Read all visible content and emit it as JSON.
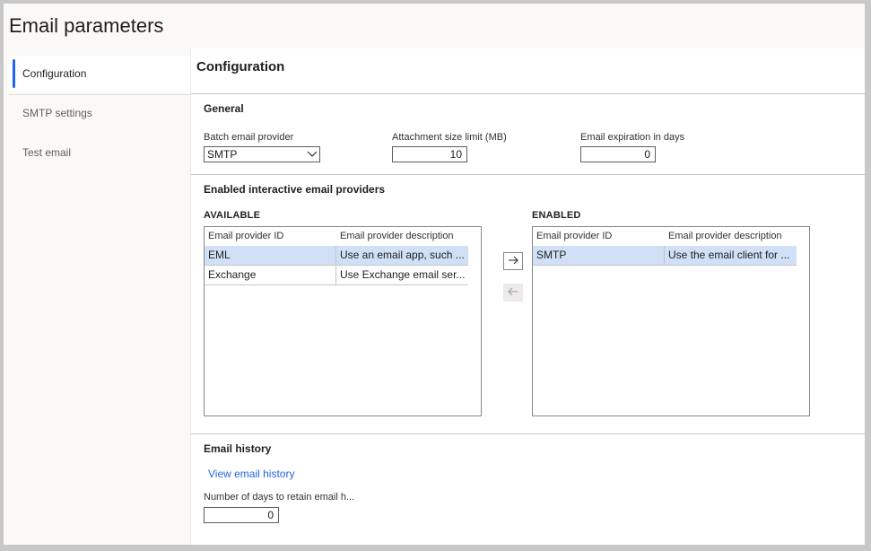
{
  "page": {
    "title": "Email parameters"
  },
  "nav": {
    "items": [
      {
        "label": "Configuration",
        "active": true
      },
      {
        "label": "SMTP settings",
        "active": false
      },
      {
        "label": "Test email",
        "active": false
      }
    ]
  },
  "main": {
    "title": "Configuration",
    "general": {
      "title": "General",
      "batch_provider": {
        "label": "Batch email provider",
        "value": "SMTP"
      },
      "attachment_limit": {
        "label": "Attachment size limit (MB)",
        "value": "10"
      },
      "expiration_days": {
        "label": "Email expiration in days",
        "value": "0"
      }
    },
    "interactive": {
      "title": "Enabled interactive email providers",
      "available": {
        "label": "AVAILABLE",
        "columns": [
          "Email provider ID",
          "Email provider description"
        ],
        "rows": [
          {
            "id": "EML",
            "description": "Use an email app, such ...",
            "selected": true
          },
          {
            "id": "Exchange",
            "description": "Use Exchange email ser...",
            "selected": false
          }
        ]
      },
      "enabled": {
        "label": "ENABLED",
        "columns": [
          "Email provider ID",
          "Email provider description"
        ],
        "rows": [
          {
            "id": "SMTP",
            "description": "Use the email client for ...",
            "selected": true
          }
        ]
      }
    },
    "history": {
      "title": "Email history",
      "link": "View email history",
      "retain_days": {
        "label": "Number of days to retain email h...",
        "value": "0"
      }
    }
  },
  "colors": {
    "accent": "#2266e3",
    "selection": "#cfe0f7"
  },
  "icons": {
    "add": "arrow-right-icon",
    "remove": "arrow-left-icon",
    "dropdown": "chevron-down-icon"
  }
}
